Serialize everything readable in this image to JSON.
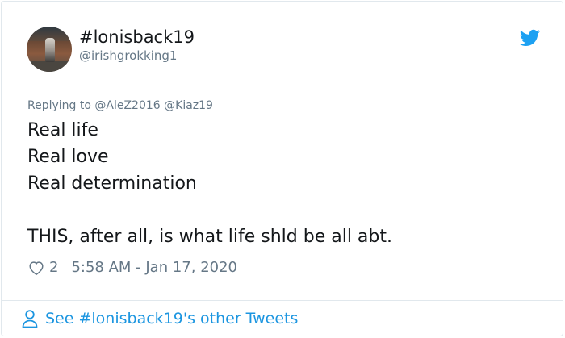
{
  "user": {
    "display_name": "#lonisback19",
    "handle": "@irishgrokking1"
  },
  "tweet": {
    "replying_prefix": "Replying to",
    "replying_to": [
      "@AleZ2016",
      "@Kiaz19"
    ],
    "lines": [
      "Real life",
      "Real love",
      "Real determination",
      "",
      "THIS, after all, is what life shld be all abt."
    ],
    "likes": "2",
    "timestamp": "5:58 AM - Jan 17, 2020"
  },
  "footer": {
    "link_text": "See #lonisback19's other Tweets"
  },
  "icons": {
    "logo": "twitter-bird-icon",
    "like": "heart-outline-icon",
    "profile": "person-icon"
  },
  "colors": {
    "link_blue": "#1b95e0",
    "twitter_blue": "#1da1f2",
    "muted_gray": "#657786",
    "text": "#14171a",
    "border": "#e1e8ed"
  }
}
